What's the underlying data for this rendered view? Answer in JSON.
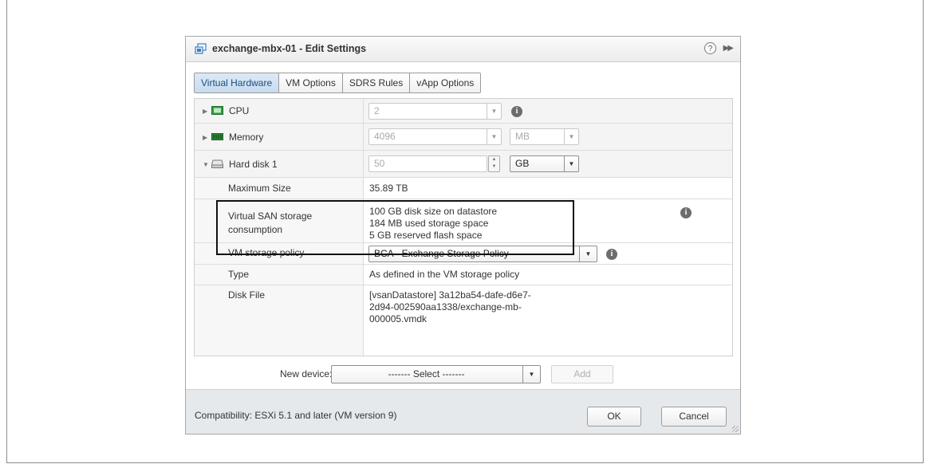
{
  "dialog": {
    "title": "exchange-mbx-01 - Edit Settings",
    "help_symbol": "?",
    "expand_symbol": "▶▶"
  },
  "tabs": [
    {
      "label": "Virtual Hardware",
      "active": true
    },
    {
      "label": "VM Options",
      "active": false
    },
    {
      "label": "SDRS Rules",
      "active": false
    },
    {
      "label": "vApp Options",
      "active": false
    }
  ],
  "hardware": {
    "cpu": {
      "label": "CPU",
      "value": "2"
    },
    "memory": {
      "label": "Memory",
      "value": "4096",
      "unit": "MB"
    },
    "hard_disk": {
      "label": "Hard disk 1",
      "value": "50",
      "unit": "GB",
      "maximum_size": {
        "label": "Maximum Size",
        "value": "35.89 TB"
      },
      "vsan": {
        "label_line1": "Virtual SAN storage",
        "label_line2": "consumption",
        "line1": "100 GB disk size on datastore",
        "line2": "184 MB used storage space",
        "line3": "5 GB reserved flash space"
      },
      "storage_policy": {
        "label": "VM storage policy",
        "value": "BCA - Exchange Storage Policy"
      },
      "type": {
        "label": "Type",
        "value": "As defined in the VM storage policy"
      },
      "disk_file": {
        "label": "Disk File",
        "line1": "[vsanDatastore] 3a12ba54-dafe-d6e7-",
        "line2": "2d94-002590aa1338/exchange-mb-",
        "line3": "000005.vmdk"
      }
    }
  },
  "new_device": {
    "label": "New device:",
    "select_value": "------- Select -------",
    "add_label": "Add"
  },
  "footer": {
    "compatibility": "Compatibility: ESXi 5.1 and later (VM version 9)",
    "ok_label": "OK",
    "cancel_label": "Cancel"
  },
  "icons": {
    "info": "i",
    "caret_right": "▶",
    "caret_down": "▼",
    "dropdown": "▼",
    "spin_up": "▲",
    "spin_down": "▼"
  }
}
